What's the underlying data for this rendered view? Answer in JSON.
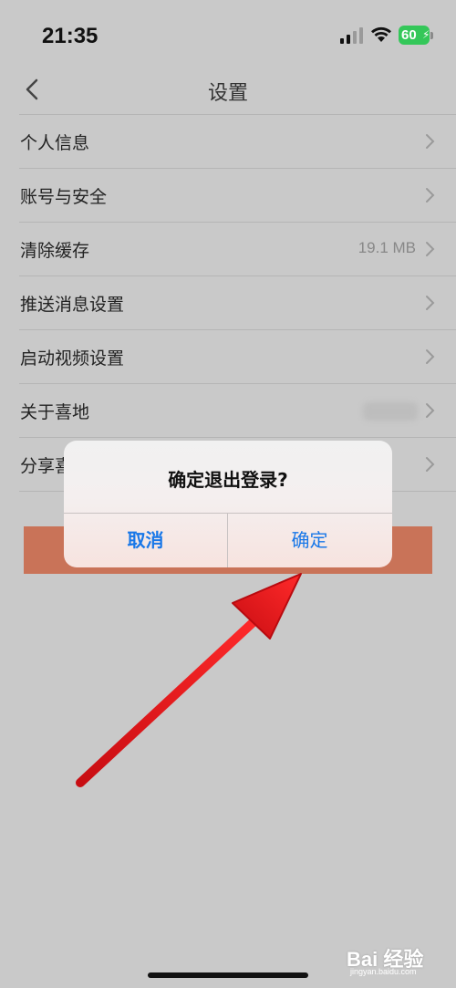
{
  "status_bar": {
    "time": "21:35",
    "battery_level": "60",
    "icons": [
      "signal-icon",
      "wifi-icon",
      "battery-icon"
    ]
  },
  "nav": {
    "title": "设置",
    "back_icon": "chevron-left-icon"
  },
  "settings": {
    "items": [
      {
        "label": "个人信息",
        "value": ""
      },
      {
        "label": "账号与安全",
        "value": ""
      },
      {
        "label": "清除缓存",
        "value": "19.1 MB"
      },
      {
        "label": "推送消息设置",
        "value": ""
      },
      {
        "label": "启动视频设置",
        "value": ""
      },
      {
        "label": "关于喜地",
        "value": ""
      },
      {
        "label": "分享喜",
        "value": ""
      }
    ]
  },
  "dialog": {
    "title": "确定退出登录?",
    "cancel_label": "取消",
    "confirm_label": "确定"
  },
  "watermark": {
    "text": "Bai 经验",
    "sub": "jingyan.baidu.com"
  },
  "colors": {
    "accent": "#1877e8",
    "logout_button": "#c97358",
    "arrow": "#e8141b",
    "battery": "#34c759"
  }
}
